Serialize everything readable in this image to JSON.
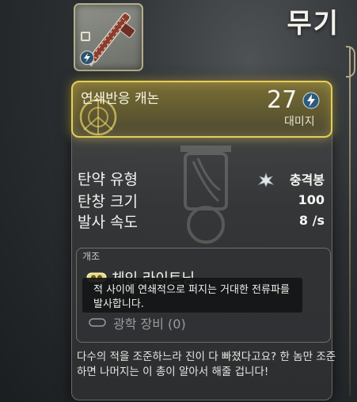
{
  "screen": {
    "title": "무기"
  },
  "weapon": {
    "thumbnail_icon": "chain-cannon-rifle-icon",
    "thumbnail_badges": [
      "ammo-icon",
      "lightning-icon"
    ],
    "name": "연쇄반응 캐논",
    "damage_value": "27",
    "damage_icon": "lightning-icon",
    "damage_label": "대미지",
    "accent_color": "#e5cf57"
  },
  "stats": [
    {
      "label": "탄약 유형",
      "value": "충격봉",
      "icon": "impact-star-icon"
    },
    {
      "label": "탄창 크기",
      "value": "100"
    },
    {
      "label": "발사 속도",
      "value": "8 /s"
    }
  ],
  "mods": {
    "section_label": "개조",
    "items": [
      {
        "name": "체인 라이트닝",
        "icon": "chain-mod-icon",
        "tooltip": "적 사이에 연쇄적으로 퍼지는 거대한 전류파를 발사합니다."
      },
      {
        "name": "광학 장비 (0)",
        "icon": "empty-slot-icon"
      }
    ]
  },
  "description": "다수의 적을 조준하느라 진이 다 빠졌다고요? 한 놈만 조준하면 나머지는 이 총이 알아서 해줄 겁니다!"
}
